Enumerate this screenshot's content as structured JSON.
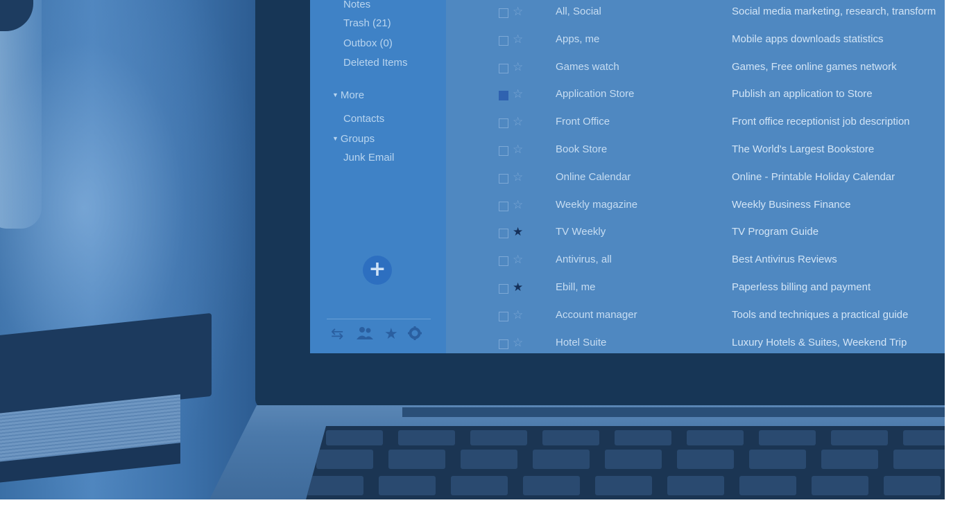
{
  "sidebar": {
    "folders": [
      "Notes",
      "Trash (21)",
      "Outbox (0)",
      "Deleted Items"
    ],
    "more_label": "More",
    "contacts_label": "Contacts",
    "groups_label": "Groups",
    "junk_label": "Junk Email",
    "compose_icon": "plus-circle-icon",
    "tools": [
      "swap-icon",
      "users-icon",
      "star-icon",
      "gear-icon"
    ]
  },
  "emails": [
    {
      "sender": "All, Social",
      "subject": "Social media marketing, research, transform",
      "checked": false,
      "starred": false
    },
    {
      "sender": "Apps, me",
      "subject": "Mobile apps downloads statistics",
      "checked": false,
      "starred": false
    },
    {
      "sender": "Games watch",
      "subject": "Games, Free online games network",
      "checked": false,
      "starred": false
    },
    {
      "sender": "Application Store",
      "subject": "Publish an application to Store",
      "checked": true,
      "starred": false
    },
    {
      "sender": "Front Office",
      "subject": "Front office receptionist job description",
      "checked": false,
      "starred": false
    },
    {
      "sender": "Book Store",
      "subject": "The World's Largest  Bookstore",
      "checked": false,
      "starred": false
    },
    {
      "sender": "Online Calendar",
      "subject": "Online - Printable Holiday Calendar",
      "checked": false,
      "starred": false
    },
    {
      "sender": "Weekly magazine",
      "subject": "Weekly Business Finance",
      "checked": false,
      "starred": false
    },
    {
      "sender": "TV Weekly",
      "subject": "TV Program Guide",
      "checked": false,
      "starred": true
    },
    {
      "sender": "Antivirus, all",
      "subject": "Best Antivirus Reviews",
      "checked": false,
      "starred": false
    },
    {
      "sender": "Ebill, me",
      "subject": "Paperless billing and payment",
      "checked": false,
      "starred": true
    },
    {
      "sender": "Account manager",
      "subject": "Tools and techniques a practical guide",
      "checked": false,
      "starred": false
    },
    {
      "sender": "Hotel Suite",
      "subject": "Luxury Hotels & Suites, Weekend Trip",
      "checked": false,
      "starred": false
    }
  ],
  "colors": {
    "overlay": "#2f5f93",
    "sidebar": "#3f82c6",
    "mail_list": "#4f88c1",
    "accent": "#2f62b0"
  }
}
